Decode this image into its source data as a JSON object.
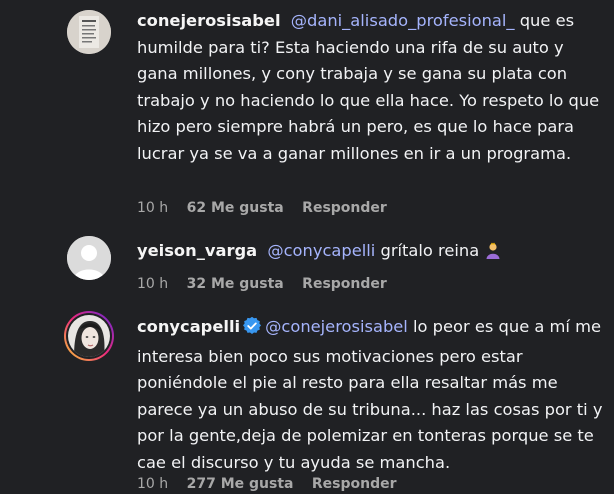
{
  "comments": [
    {
      "username": "conejerosisabel",
      "mention": "@dani_alisado_profesional_",
      "text": " que es humilde para ti? Esta haciendo una rifa de su auto y gana millones, y cony trabaja y se gana su plata con trabajo y no haciendo lo que ella hace. Yo respeto lo que hizo pero siempre habrá un pero, es que lo hace para lucrar ya se va a ganar millones en ir a un programa.",
      "time": "10 h",
      "likes": "62 Me gusta",
      "reply": "Responder"
    },
    {
      "username": "yeison_varga",
      "mention": "@conycapelli",
      "text": " grítalo reina ",
      "emoji": "person-bowing-icon",
      "time": "10 h",
      "likes": "32 Me gusta",
      "reply": "Responder"
    },
    {
      "username": "conycapelli",
      "verified": true,
      "mention": "@conejerosisabel",
      "text": " lo peor es que a mí me interesa bien poco sus motivaciones pero estar poniéndole el pie al resto para ella resaltar más me parece ya un abuso de su tribuna... haz las cosas por ti y por la gente,deja de polemizar en tonteras porque se te cae el discurso y tu ayuda se mancha.",
      "time": "10 h",
      "likes": "277 Me gusta",
      "reply": "Responder"
    }
  ],
  "colors": {
    "background": "#202124",
    "mention": "#a5b4fc",
    "meta": "#a8a8a8",
    "verified": "#3897f0"
  }
}
